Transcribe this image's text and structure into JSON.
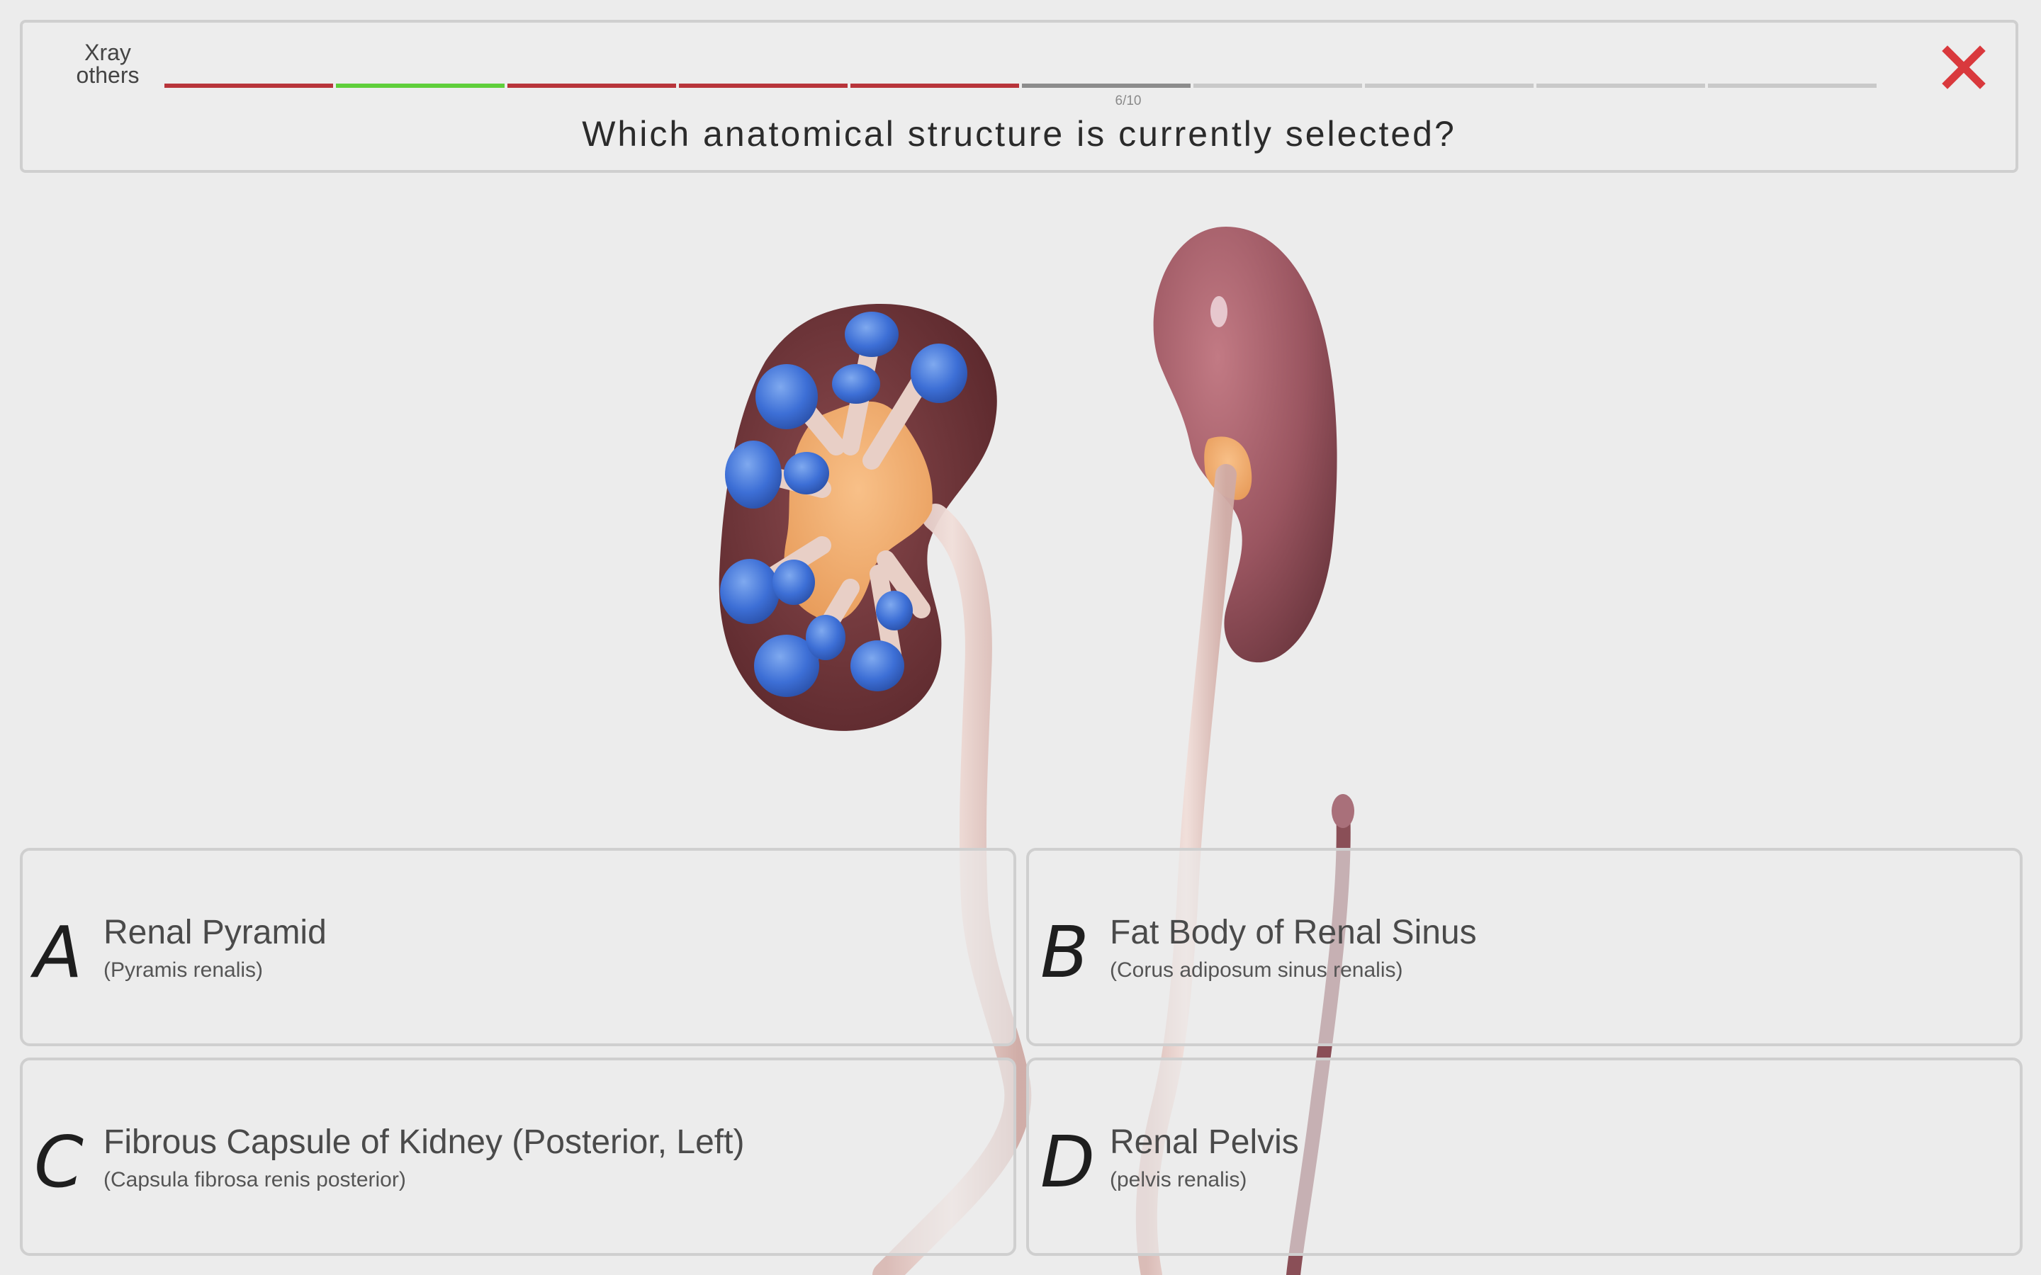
{
  "header": {
    "category": "Xray others",
    "question": "Which anatomical structure is currently selected?",
    "progress_label": "6/10",
    "progress": {
      "current": 6,
      "total": 10,
      "results": [
        "wrong",
        "correct",
        "wrong",
        "wrong",
        "wrong",
        "current",
        "pending",
        "pending",
        "pending",
        "pending"
      ]
    },
    "close_icon": "close-icon"
  },
  "colors": {
    "wrong": "#b8343a",
    "correct": "#5fcf3b",
    "current": "#8c8c8c",
    "pending": "#c9c9c9",
    "close": "#d9393d"
  },
  "answers": [
    {
      "letter": "A",
      "name": "Renal Pyramid",
      "latin": "(Pyramis renalis)"
    },
    {
      "letter": "B",
      "name": "Fat Body of Renal Sinus",
      "latin": "(Corus adiposum sinus renalis)"
    },
    {
      "letter": "C",
      "name": "Fibrous Capsule of Kidney (Posterior, Left)",
      "latin": "(Capsula fibrosa renis  posterior)"
    },
    {
      "letter": "D",
      "name": "Renal Pelvis",
      "latin": "(pelvis renalis)"
    }
  ]
}
